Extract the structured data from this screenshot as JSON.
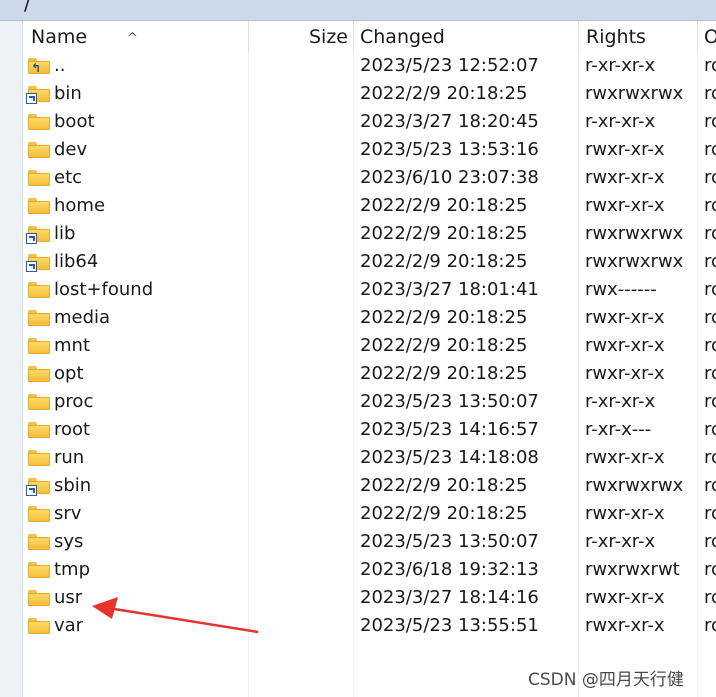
{
  "path": "/",
  "columns": {
    "name": "Name",
    "size": "Size",
    "changed": "Changed",
    "rights": "Rights",
    "owner": "O"
  },
  "rows": [
    {
      "name": "..",
      "changed": "2023/5/23 12:52:07",
      "rights": "r-xr-xr-x",
      "owner": "ro",
      "icon": "parent-folder-icon"
    },
    {
      "name": "bin",
      "changed": "2022/2/9 20:18:25",
      "rights": "rwxrwxrwx",
      "owner": "ro",
      "icon": "folder-link-icon"
    },
    {
      "name": "boot",
      "changed": "2023/3/27 18:20:45",
      "rights": "r-xr-xr-x",
      "owner": "ro",
      "icon": "folder-icon"
    },
    {
      "name": "dev",
      "changed": "2023/5/23 13:53:16",
      "rights": "rwxr-xr-x",
      "owner": "ro",
      "icon": "folder-icon"
    },
    {
      "name": "etc",
      "changed": "2023/6/10 23:07:38",
      "rights": "rwxr-xr-x",
      "owner": "ro",
      "icon": "folder-icon"
    },
    {
      "name": "home",
      "changed": "2022/2/9 20:18:25",
      "rights": "rwxr-xr-x",
      "owner": "ro",
      "icon": "folder-icon"
    },
    {
      "name": "lib",
      "changed": "2022/2/9 20:18:25",
      "rights": "rwxrwxrwx",
      "owner": "ro",
      "icon": "folder-link-icon"
    },
    {
      "name": "lib64",
      "changed": "2022/2/9 20:18:25",
      "rights": "rwxrwxrwx",
      "owner": "ro",
      "icon": "folder-link-icon"
    },
    {
      "name": "lost+found",
      "changed": "2023/3/27 18:01:41",
      "rights": "rwx------",
      "owner": "ro",
      "icon": "folder-icon"
    },
    {
      "name": "media",
      "changed": "2022/2/9 20:18:25",
      "rights": "rwxr-xr-x",
      "owner": "ro",
      "icon": "folder-icon"
    },
    {
      "name": "mnt",
      "changed": "2022/2/9 20:18:25",
      "rights": "rwxr-xr-x",
      "owner": "ro",
      "icon": "folder-icon"
    },
    {
      "name": "opt",
      "changed": "2022/2/9 20:18:25",
      "rights": "rwxr-xr-x",
      "owner": "ro",
      "icon": "folder-icon"
    },
    {
      "name": "proc",
      "changed": "2023/5/23 13:50:07",
      "rights": "r-xr-xr-x",
      "owner": "ro",
      "icon": "folder-icon"
    },
    {
      "name": "root",
      "changed": "2023/5/23 14:16:57",
      "rights": "r-xr-x---",
      "owner": "ro",
      "icon": "folder-icon"
    },
    {
      "name": "run",
      "changed": "2023/5/23 14:18:08",
      "rights": "rwxr-xr-x",
      "owner": "ro",
      "icon": "folder-icon"
    },
    {
      "name": "sbin",
      "changed": "2022/2/9 20:18:25",
      "rights": "rwxrwxrwx",
      "owner": "ro",
      "icon": "folder-link-icon"
    },
    {
      "name": "srv",
      "changed": "2022/2/9 20:18:25",
      "rights": "rwxr-xr-x",
      "owner": "ro",
      "icon": "folder-icon"
    },
    {
      "name": "sys",
      "changed": "2023/5/23 13:50:07",
      "rights": "r-xr-xr-x",
      "owner": "ro",
      "icon": "folder-icon"
    },
    {
      "name": "tmp",
      "changed": "2023/6/18 19:32:13",
      "rights": "rwxrwxrwt",
      "owner": "ro",
      "icon": "folder-icon"
    },
    {
      "name": "usr",
      "changed": "2023/3/27 18:14:16",
      "rights": "rwxr-xr-x",
      "owner": "ro",
      "icon": "folder-icon"
    },
    {
      "name": "var",
      "changed": "2023/5/23 13:55:51",
      "rights": "rwxr-xr-x",
      "owner": "ro",
      "icon": "folder-icon"
    }
  ],
  "annotation": {
    "color": "#e8332c",
    "points_to": "usr"
  },
  "watermark": "CSDN @四月天行健"
}
